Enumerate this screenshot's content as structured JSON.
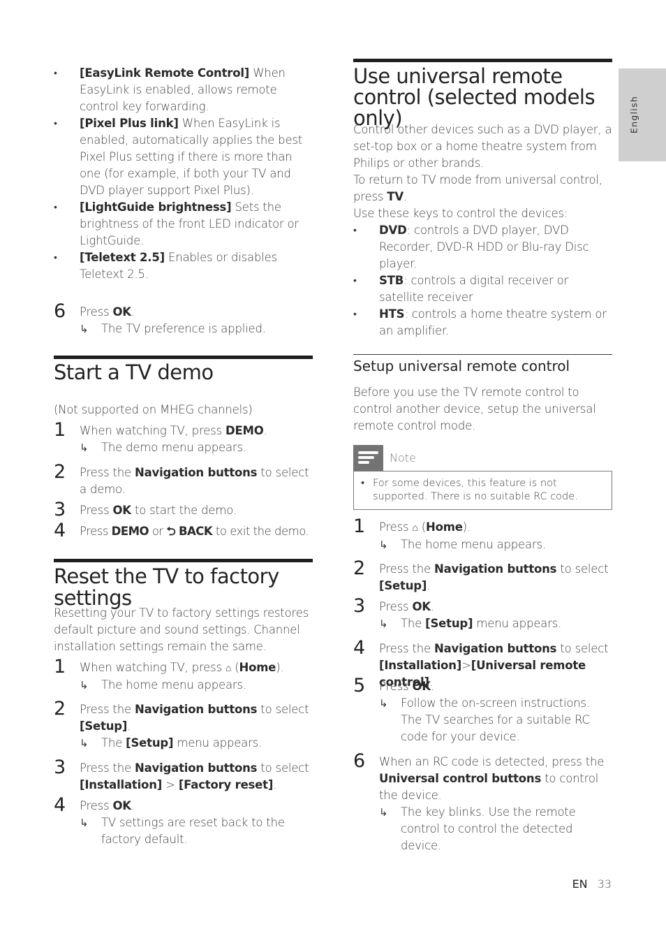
{
  "left_column": {
    "settings_bullets": [
      {
        "term": "[EasyLink Remote Control]",
        "desc": " When EasyLink is enabled, allows remote control key forwarding."
      },
      {
        "term": "[Pixel Plus link]",
        "desc": " When EasyLink is enabled, automatically applies the best Pixel Plus setting if there is more than one (for example, if both your TV and DVD player support Pixel Plus)."
      },
      {
        "term": "[LightGuide brightness]",
        "desc": " Sets the brightness of the front LED indicator or LightGuide."
      },
      {
        "term": "[Teletext 2.5]",
        "desc": " Enables or disables Teletext 2.5."
      }
    ],
    "step6": {
      "num": "6",
      "pre": "Press ",
      "key": "OK",
      "post": ".",
      "result": "The TV preference is applied."
    },
    "demo": {
      "title": "Start a TV demo",
      "intro": "(Not supported on MHEG channels)",
      "steps": [
        {
          "num": "1",
          "pre": "When watching TV, press ",
          "key": "DEMO",
          "post": ".",
          "result": "The demo menu appears."
        },
        {
          "num": "2",
          "pre": "Press the ",
          "key": "Navigation buttons",
          "post": " to select a demo."
        },
        {
          "num": "3",
          "pre": "Press ",
          "key": "OK",
          "post": " to start the demo."
        },
        {
          "num": "4",
          "pre": "Press ",
          "key": "DEMO",
          "mid": " or ",
          "key2": "BACK",
          "post": " to exit the demo."
        }
      ]
    },
    "reset": {
      "title": "Reset the TV to factory settings",
      "intro": "Resetting your TV to factory settings restores default picture and sound settings. Channel installation settings remain the same.",
      "steps": [
        {
          "num": "1",
          "pre": "When watching TV, press ",
          "key": "Home",
          "post": ").",
          "result": "The home menu appears."
        },
        {
          "num": "2",
          "pre": "Press the ",
          "key": "Navigation buttons",
          "post": " to select ",
          "key2": "[Setup]",
          "post2": ".",
          "result_pre": "The ",
          "result_key": "[Setup]",
          "result_post": " menu appears."
        },
        {
          "num": "3",
          "pre": "Press the ",
          "key": "Navigation buttons",
          "post": " to select ",
          "key2": "[Installation]",
          "mid": " > ",
          "key3": "[Factory reset]",
          "post2": "."
        },
        {
          "num": "4",
          "pre": "Press ",
          "key": "OK",
          "post": ".",
          "result": "TV settings are reset back to the factory default."
        }
      ]
    }
  },
  "right_column": {
    "title": "Use universal remote control (selected models only)",
    "intro1": "Control other devices such as a DVD player, a set-top box or a home theatre system from Philips or other brands.",
    "intro2_pre": "To return to TV mode from universal control, press ",
    "intro2_key": "TV",
    "intro2_post": ".",
    "intro3": "Use these keys to control the devices:",
    "keys": [
      {
        "key": "DVD",
        "desc": ": controls a DVD player, DVD Recorder, DVD-R HDD or Blu-ray Disc player."
      },
      {
        "key": "STB",
        "desc": ": controls a digital receiver or satellite receiver"
      },
      {
        "key": "HTS",
        "desc": ": controls a home theatre system or an amplifier."
      }
    ],
    "setup": {
      "title": "Setup universal remote control",
      "intro": "Before you use the TV remote control to control another device, setup the universal remote control mode.",
      "note_title": "Note",
      "note_text": "For some devices, this feature is not supported. There is no suitable RC code.",
      "steps": [
        {
          "num": "1",
          "pre": "Press ",
          "key": "Home",
          "post": ").",
          "result": "The home menu appears."
        },
        {
          "num": "2",
          "pre": "Press the ",
          "key": "Navigation buttons",
          "post": " to select ",
          "key2": "[Setup]",
          "post2": "."
        },
        {
          "num": "3",
          "pre": "Press ",
          "key": "OK",
          "post": ".",
          "result_pre": "The ",
          "result_key": "[Setup]",
          "result_post": " menu appears."
        },
        {
          "num": "4",
          "pre": "Press the ",
          "key": "Navigation buttons",
          "post": " to select ",
          "key2": "[Installation]",
          "mid": ">",
          "key3": "[Universal remote control]",
          "post2": "."
        },
        {
          "num": "5",
          "pre": "Press ",
          "key": "OK",
          "post": ".",
          "result": "Follow the on-screen instructions. The TV searches for a suitable RC code for your device."
        },
        {
          "num": "6",
          "pre": "When an RC code is detected, press the ",
          "key": "Universal control buttons",
          "post": " to control the device.",
          "result": "The key blinks. Use the remote control to control the detected device."
        }
      ]
    }
  },
  "side_tab": {
    "label": "English"
  },
  "footer": {
    "lang": "EN",
    "page": "33"
  },
  "symbols": {
    "arrow": "↳",
    "home": "⌂",
    "back": "⮌",
    "open_paren": " ("
  }
}
